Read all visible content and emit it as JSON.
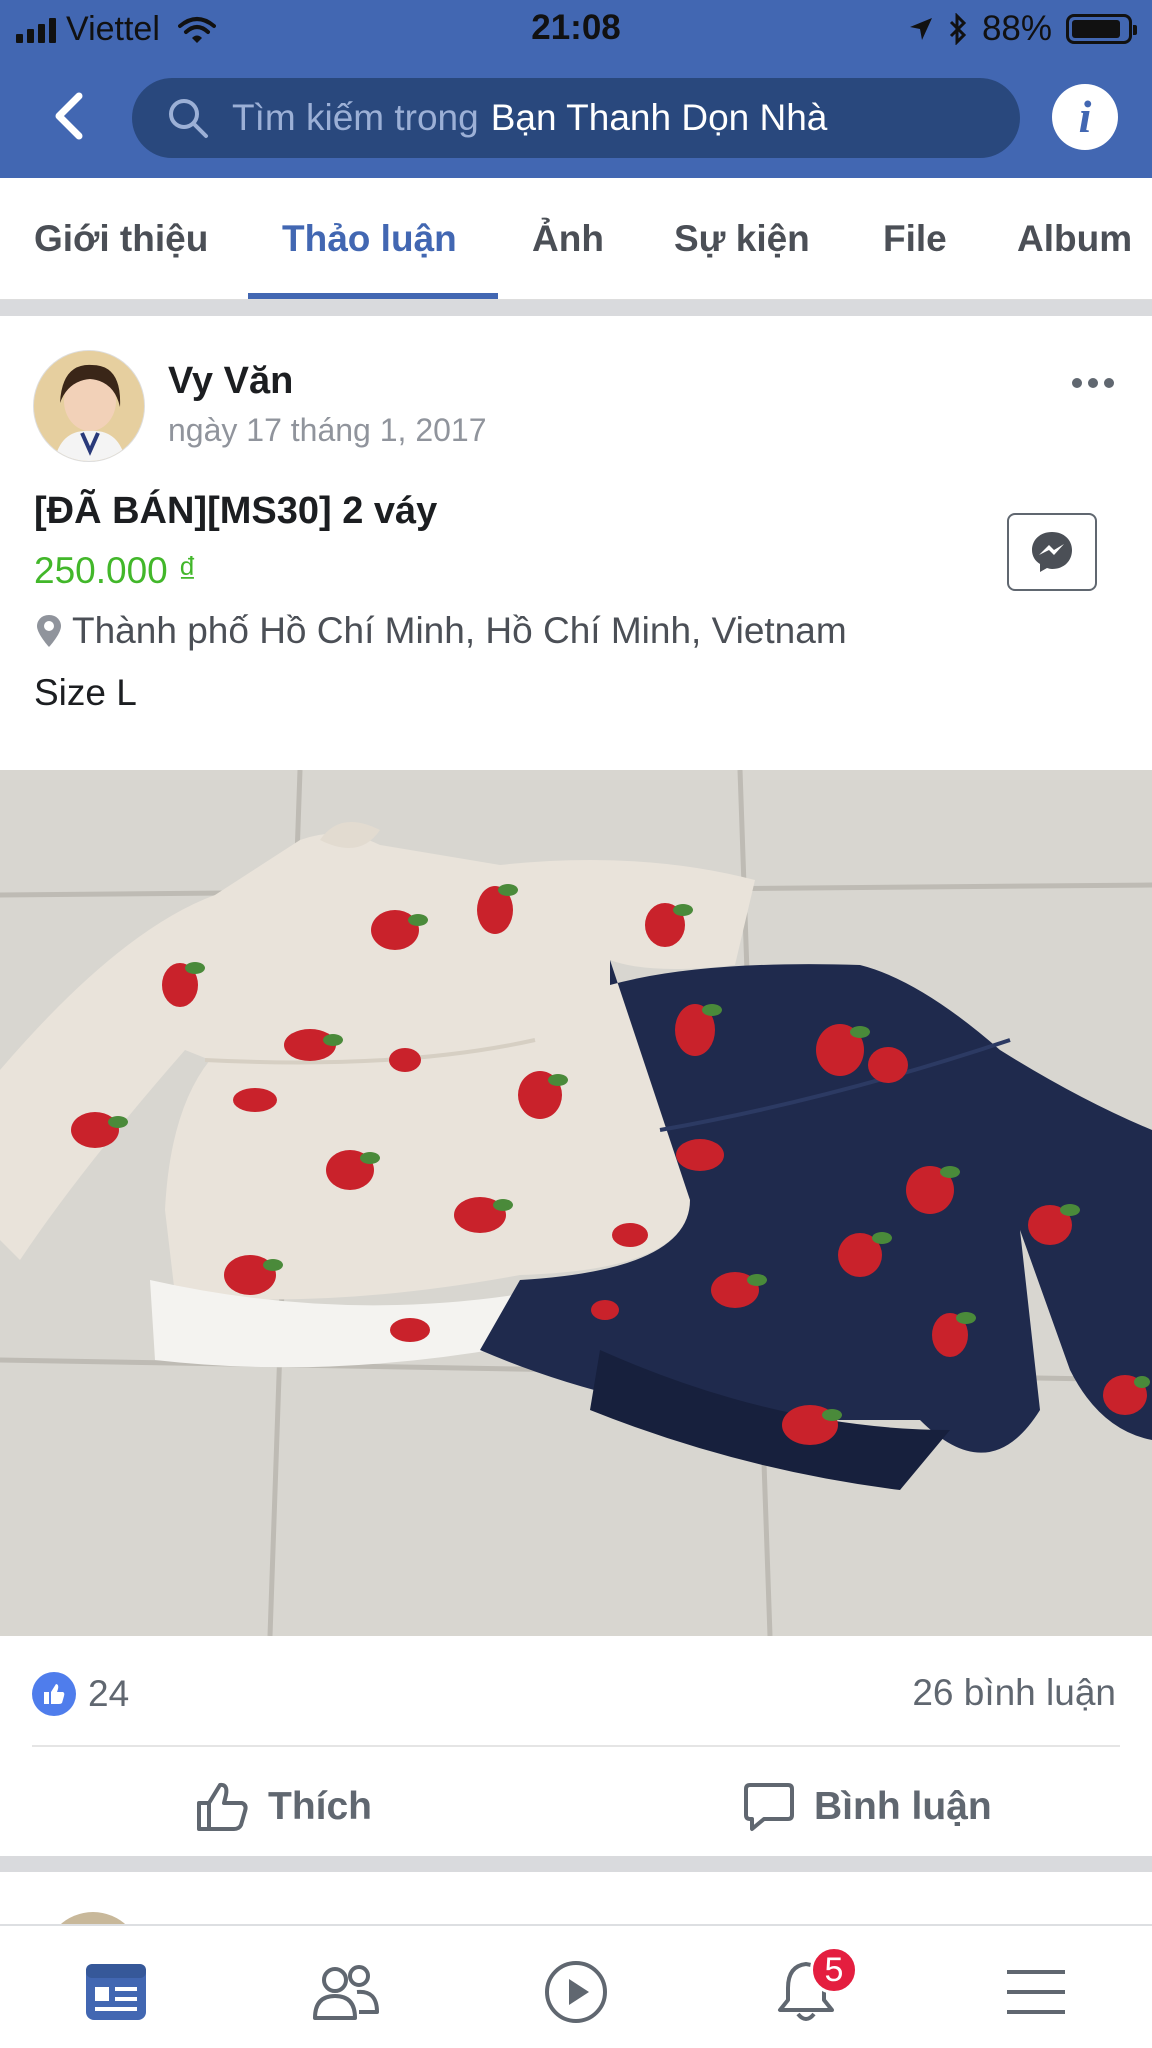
{
  "status_bar": {
    "carrier": "Viettel",
    "time": "21:08",
    "battery": "88%",
    "battery_level": 0.88
  },
  "header": {
    "search_placeholder": "Tìm kiếm trong",
    "group_name": "Bạn Thanh Dọn Nhà",
    "accent_color": "#4267b2"
  },
  "tabs": [
    {
      "label": "Giới thiệu"
    },
    {
      "label": "Thảo luận",
      "active": true
    },
    {
      "label": "Ảnh"
    },
    {
      "label": "Sự kiện"
    },
    {
      "label": "File"
    },
    {
      "label": "Album"
    }
  ],
  "post": {
    "author": "Vy Văn",
    "date": "ngày 17 tháng 1, 2017",
    "title": "[ĐÃ BÁN][MS30] 2 váy",
    "price": "250.000 ₫",
    "price_color": "#42b72a",
    "location": "Thành phố Hồ Chí Minh, Hồ Chí Minh, Vietnam",
    "description": "Size L",
    "like_count": "24",
    "comment_count": "26 bình luận",
    "like_label": "Thích",
    "comment_label": "Bình luận"
  },
  "bottom_nav": {
    "notification_badge": "5",
    "items": [
      "news-feed-icon",
      "friends-icon",
      "watch-icon",
      "notifications-icon",
      "menu-icon"
    ]
  }
}
